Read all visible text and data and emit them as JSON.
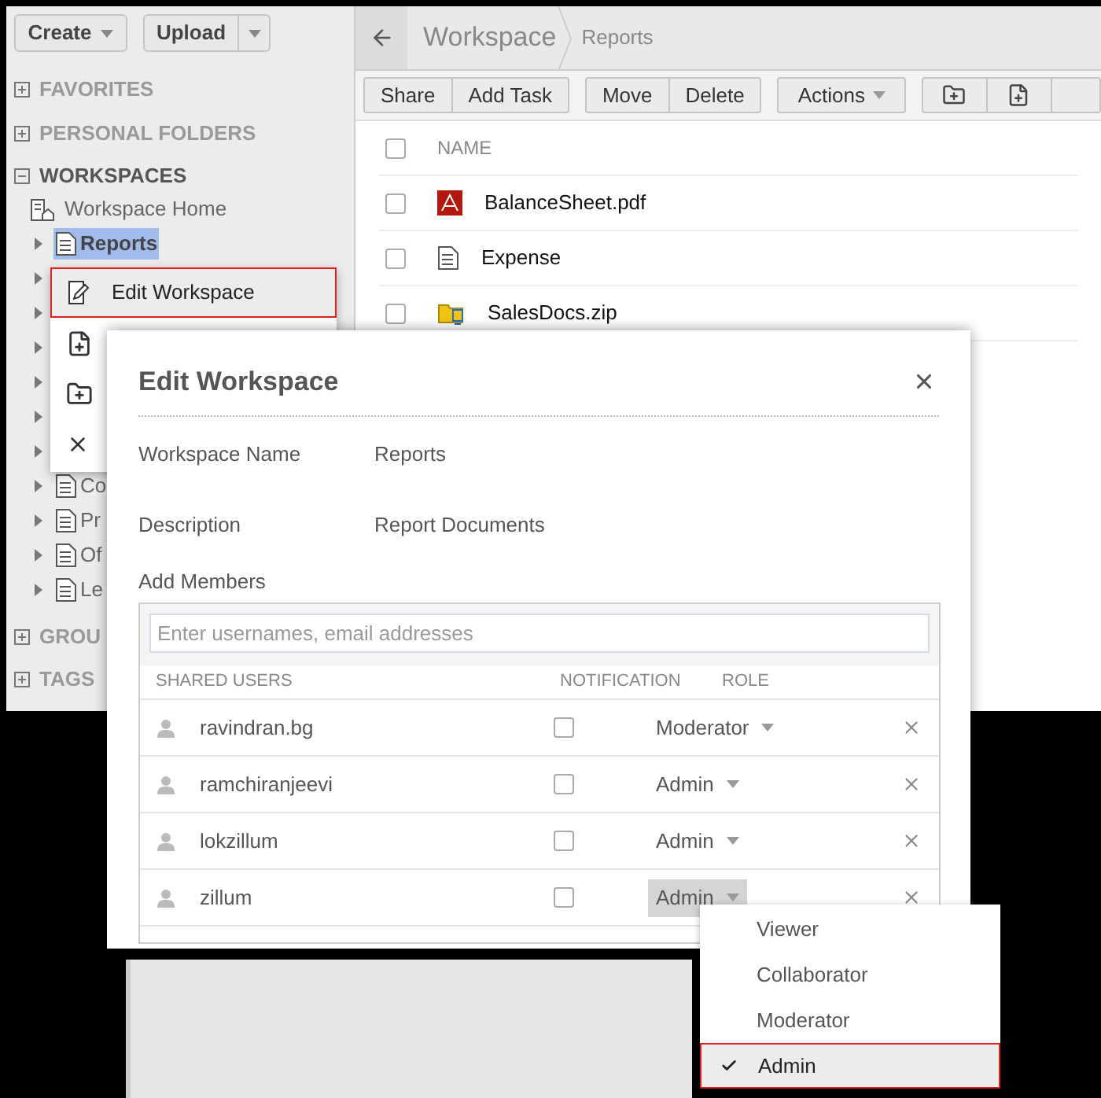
{
  "top_buttons": {
    "create": "Create",
    "upload": "Upload"
  },
  "sidebar": {
    "sections": [
      {
        "label": "FAVORITES",
        "expanded": false
      },
      {
        "label": "PERSONAL FOLDERS",
        "expanded": false
      },
      {
        "label": "WORKSPACES",
        "expanded": true
      },
      {
        "label": "GROU",
        "expanded": false
      },
      {
        "label": "TAGS",
        "expanded": false
      }
    ],
    "home": "Workspace Home",
    "tree": [
      {
        "label": "Reports",
        "selected": true,
        "kind": "report"
      },
      {
        "kind": "hidden"
      },
      {
        "kind": "hidden"
      },
      {
        "kind": "hidden"
      },
      {
        "kind": "hidden"
      },
      {
        "kind": "hidden"
      },
      {
        "kind": "hidden"
      },
      {
        "label": "Co",
        "selected": false,
        "kind": "doc"
      },
      {
        "label": "Pr",
        "selected": false,
        "kind": "doc"
      },
      {
        "label": "Of",
        "selected": false,
        "kind": "shared"
      },
      {
        "label": "Le",
        "selected": false,
        "kind": "shared"
      }
    ]
  },
  "breadcrumb": [
    "Workspace",
    "Reports"
  ],
  "toolbar": {
    "groups": [
      [
        "Share",
        "Add Task"
      ],
      [
        "Move",
        "Delete"
      ]
    ],
    "actions": "Actions"
  },
  "files": {
    "header": "NAME",
    "all_checked": false,
    "rows": [
      {
        "name": "BalanceSheet.pdf",
        "kind": "pdf",
        "checked": false
      },
      {
        "name": "Expense",
        "kind": "doc",
        "checked": false
      },
      {
        "name": "SalesDocs.zip",
        "kind": "zip",
        "checked": false
      }
    ]
  },
  "context_menu": [
    {
      "kind": "edit",
      "label": "Edit Workspace",
      "selected": true
    },
    {
      "kind": "add-doc",
      "selected": false
    },
    {
      "kind": "add-folder",
      "selected": false
    },
    {
      "kind": "delete",
      "selected": false
    }
  ],
  "dialog": {
    "title": "Edit Workspace",
    "fields": [
      {
        "label": "Workspace Name",
        "value": "Reports"
      },
      {
        "label": "Description",
        "value": "Report Documents"
      }
    ],
    "members_label": "Add Members",
    "search": {
      "placeholder": "Enter usernames, email addresses"
    },
    "columns": [
      "SHARED USERS",
      "NOTIFICATION",
      "ROLE"
    ],
    "members": [
      {
        "name": "ravindran.bg",
        "notify": false,
        "role": "Moderator",
        "open": false
      },
      {
        "name": "ramchiranjeevi",
        "notify": false,
        "role": "Admin",
        "open": false
      },
      {
        "name": "lokzillum",
        "notify": false,
        "role": "Admin",
        "open": false
      },
      {
        "name": "zillum",
        "notify": false,
        "role": "Admin",
        "open": true
      }
    ]
  },
  "role_menu": [
    {
      "label": "Viewer",
      "selected": false
    },
    {
      "label": "Collaborator",
      "selected": false
    },
    {
      "label": "Moderator",
      "selected": false
    },
    {
      "label": "Admin",
      "selected": true
    }
  ]
}
